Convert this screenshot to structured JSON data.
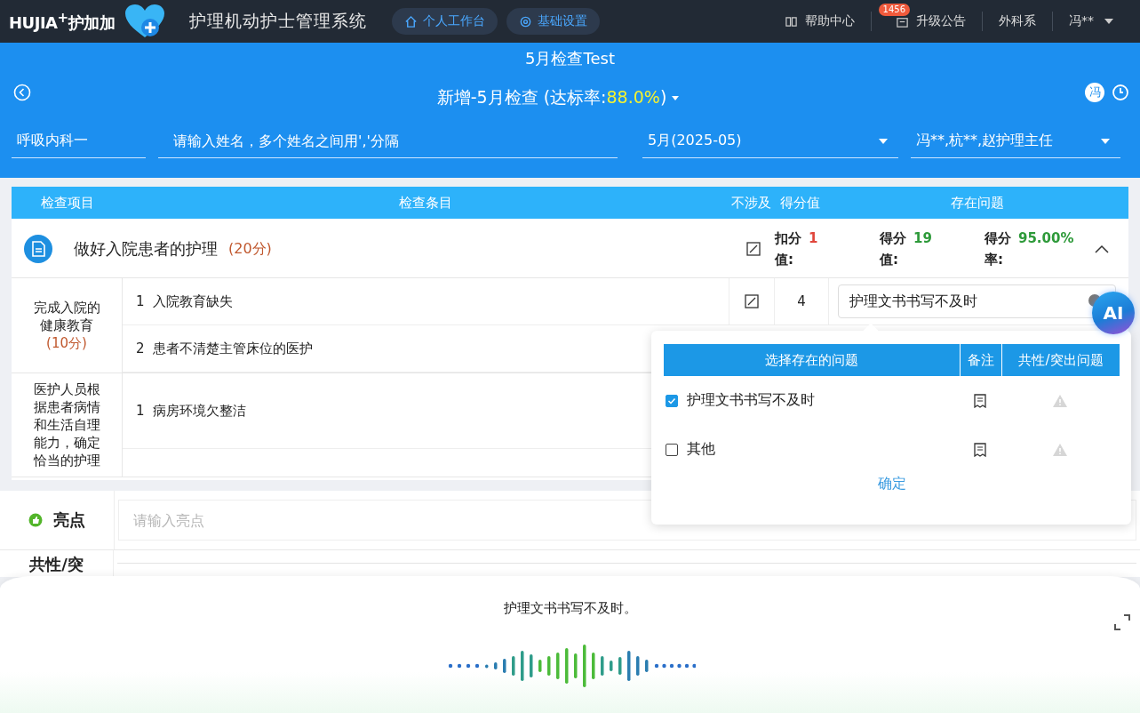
{
  "topbar": {
    "logo": "HUJIA$^{+}$护加加",
    "app_title": "护理机动护士管理系统",
    "nav": [
      "个人工作台",
      "基础设置"
    ],
    "help": "帮助中心",
    "notice": {
      "label": "升级公告",
      "badge": "1456"
    },
    "department": "外科系",
    "user": "冯**"
  },
  "header": {
    "title": "5月检查Test",
    "subtitle": "新增-5月检查 (达标率:",
    "rate": "88.0%",
    "subtitle_end": ")",
    "avatar": "冯"
  },
  "filters": [
    {
      "kind": "text",
      "value": "呼吸内科一"
    },
    {
      "kind": "input",
      "placeholder": "请输入姓名，多个姓名之间用','分隔"
    },
    {
      "kind": "select",
      "value": "5月(2025-05)"
    },
    {
      "kind": "select",
      "value": "冯**,杭**,赵护理主任"
    }
  ],
  "table": {
    "columns": [
      "检查项目",
      "检查条目",
      "不涉及",
      "得分值",
      "存在问题"
    ],
    "section": {
      "title": "做好入院患者的护理",
      "points": "(20分)",
      "expanded": true,
      "stats": [
        {
          "label": "扣分值:",
          "value": "1",
          "color": "#e0463c"
        },
        {
          "label": "得分值:",
          "value": "19",
          "color": "#2e9a3a"
        },
        {
          "label": "得分率:",
          "value": "95.00%",
          "color": "#2e9a3a"
        }
      ]
    },
    "groups": [
      {
        "name": "完成入院的健康教育",
        "points": "(10分)",
        "items": [
          {
            "no": "1",
            "text": "入院教育缺失",
            "score": "4",
            "problem": "护理文书书写不及时"
          },
          {
            "no": "2",
            "text": "患者不清楚主管床位的医护"
          }
        ]
      },
      {
        "name": "医护人员根据患者病情和生活自理能力，确定恰当的护理",
        "items": [
          {
            "no": "1",
            "text": "病房环境欠整洁"
          }
        ]
      }
    ]
  },
  "popover": {
    "columns": [
      "选择存在的问题",
      "备注",
      "共性/突出问题"
    ],
    "options": [
      {
        "label": "护理文书书写不及时",
        "checked": true
      },
      {
        "label": "其他",
        "checked": false
      }
    ],
    "confirm": "确定"
  },
  "notes": [
    {
      "label": "亮点",
      "placeholder": "请输入亮点",
      "kind": "highlight"
    },
    {
      "label": "共性/突",
      "kind": "common"
    }
  ],
  "ai": "AI",
  "voice": {
    "transcript": "护理文书书写不及时。"
  }
}
